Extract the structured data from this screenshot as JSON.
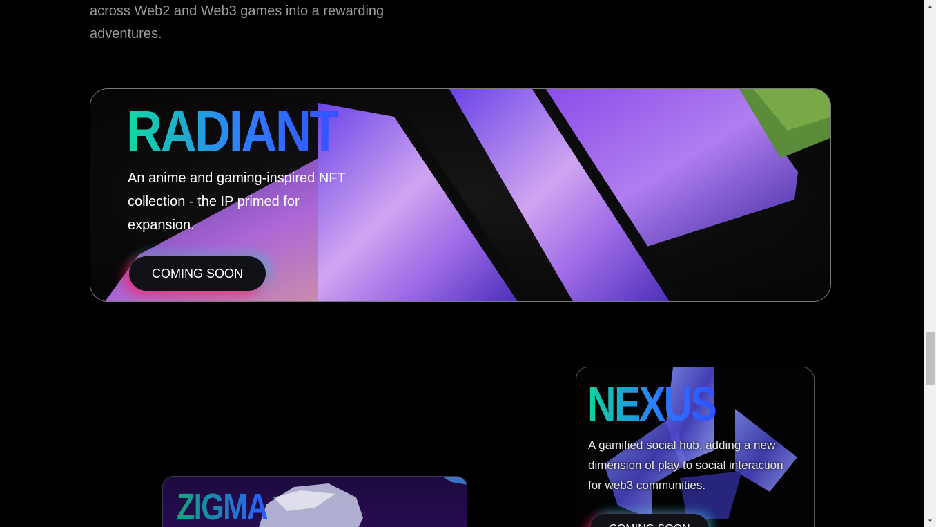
{
  "intro": {
    "text_line1": "across Web2 and Web3 games into a rewarding",
    "text_line2": "adventures."
  },
  "radiant": {
    "title": "RADIANT",
    "description": "An anime and gaming-inspired NFT collection - the IP primed for expansion.",
    "button_label": "COMING SOON"
  },
  "nexus": {
    "title": "NEXUS",
    "description": "A gamified social hub, adding a new dimension of play to social interaction for web3 communities.",
    "button_label": "COMING SOON"
  },
  "zigma": {
    "title": "ZIGMA"
  },
  "scrollbar": {
    "up_icon": "▲",
    "down_icon": "▼"
  },
  "colors": {
    "background": "#000000",
    "title_gradient_start": "#10d9a0",
    "title_gradient_end": "#3550ff",
    "button_glow_pink": "#ff1e5a",
    "button_glow_cyan": "#28c8e6"
  }
}
